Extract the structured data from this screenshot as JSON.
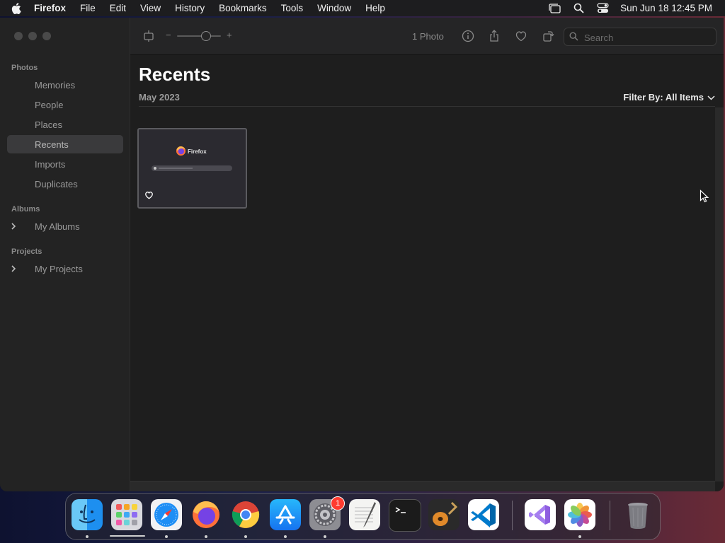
{
  "menubar": {
    "app_name": "Firefox",
    "menus": [
      "File",
      "Edit",
      "View",
      "History",
      "Bookmarks",
      "Tools",
      "Window",
      "Help"
    ],
    "clock": "Sun Jun 18  12:45 PM"
  },
  "sidebar": {
    "sections": {
      "photos": "Photos",
      "albums": "Albums",
      "projects": "Projects"
    },
    "items": {
      "memories": "Memories",
      "people": "People",
      "places": "Places",
      "recents": "Recents",
      "imports": "Imports",
      "duplicates": "Duplicates",
      "my_albums": "My Albums",
      "my_projects": "My Projects"
    },
    "selected": "recents"
  },
  "toolbar": {
    "zoom_minus": "−",
    "zoom_plus": "+",
    "zoom_level": 0.6,
    "photo_count": "1 Photo",
    "search_placeholder": "Search"
  },
  "content": {
    "title": "Recents",
    "date_header": "May 2023",
    "filter_label": "Filter By: All Items"
  },
  "thumbnail": {
    "brand_text": "Firefox",
    "favorited": false
  },
  "dock": {
    "apps": [
      "Finder",
      "Launchpad",
      "Safari",
      "Firefox",
      "Google Chrome",
      "App Store",
      "System Settings",
      "TextEdit",
      "Terminal",
      "GarageBand",
      "Visual Studio Code",
      "Visual Studio",
      "Photos",
      "Trash"
    ],
    "system_settings_badge": "1"
  },
  "colors": {
    "accent": "#0a84ff",
    "sidebar_bg": "#232323",
    "content_bg": "#1e1e1e",
    "badge": "#ff3b30"
  }
}
